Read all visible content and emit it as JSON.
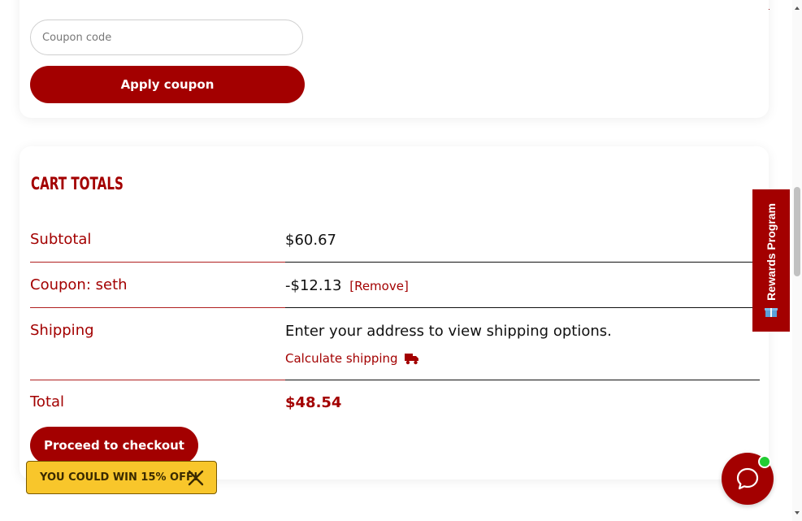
{
  "coupon": {
    "placeholder": "Coupon code",
    "apply_label": "Apply coupon"
  },
  "cart_totals": {
    "heading": "CART TOTALS",
    "subtotal": {
      "label": "Subtotal",
      "value": "$60.67"
    },
    "coupon": {
      "label": "Coupon: seth",
      "value": "-$12.13",
      "remove_label": "[Remove]"
    },
    "shipping": {
      "label": "Shipping",
      "message": "Enter your address to view shipping options.",
      "calculate_label": "Calculate shipping"
    },
    "total": {
      "label": "Total",
      "value": "$48.54"
    },
    "checkout_label": "Proceed to checkout"
  },
  "promo": {
    "text": "YOU COULD WIN 15% OFF!"
  },
  "rewards": {
    "label": "Rewards Program"
  },
  "colors": {
    "brand_red": "#a30000",
    "promo_yellow": "#f8c62b",
    "online_green": "#22cc33"
  },
  "icons": [
    "truck-icon",
    "close-icon",
    "gift-icon",
    "chat-bubble-icon"
  ]
}
